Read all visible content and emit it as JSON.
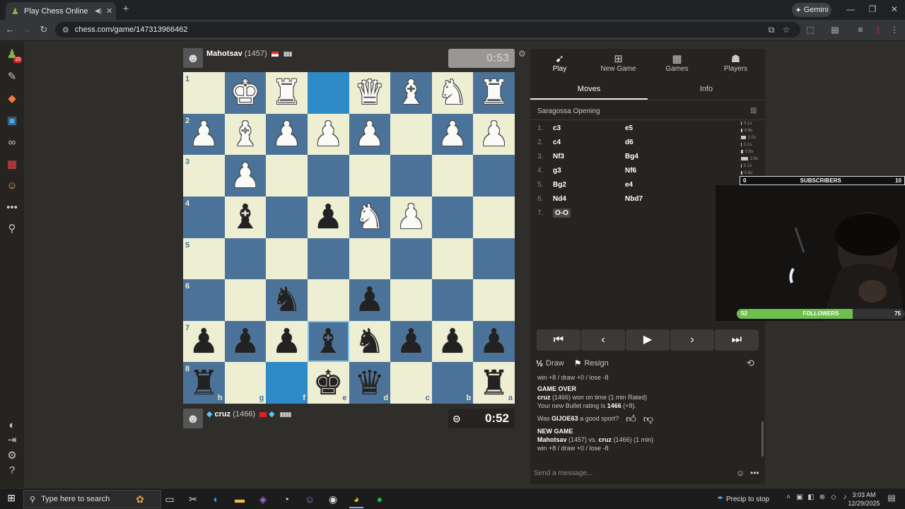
{
  "browser": {
    "tab_title": "Play Chess Online for FREE",
    "url": "chess.com/game/147313966462",
    "gemini_label": "Gemini"
  },
  "sidebar": {
    "badge": "15",
    "icons": [
      "pawn-logo-icon",
      "puzzle-icon",
      "learn-icon",
      "watch-icon",
      "binoculars-icon",
      "news-icon",
      "social-icon",
      "more-icon",
      "search-icon",
      "theme-icon",
      "logout-icon",
      "settings-icon",
      "help-icon"
    ]
  },
  "top_player": {
    "name": "Mahotsav",
    "rating": "(1457)",
    "clock": "0:53"
  },
  "bottom_player": {
    "name": "cruz",
    "rating": "(1466)",
    "clock": "0:52"
  },
  "board": {
    "ranks": [
      "1",
      "2",
      "3",
      "4",
      "5",
      "6",
      "7",
      "8"
    ],
    "files": [
      "h",
      "g",
      "f",
      "e",
      "d",
      "c",
      "b",
      "a"
    ],
    "squares": [
      [
        "",
        "wK",
        "wR",
        "",
        "wQ",
        "wB",
        "wN",
        "wR"
      ],
      [
        "wP",
        "wB",
        "wP",
        "wP",
        "wP",
        "",
        "wP",
        "wP"
      ],
      [
        "",
        "wP",
        "",
        "",
        "",
        "",
        "",
        ""
      ],
      [
        "",
        "bB",
        "",
        "bP",
        "wN",
        "wP",
        "",
        ""
      ],
      [
        "",
        "",
        "",
        "",
        "",
        "",
        "",
        ""
      ],
      [
        "",
        "",
        "bN",
        "",
        "bP",
        "",
        "",
        ""
      ],
      [
        "bP",
        "bP",
        "bP",
        "bB",
        "bN",
        "bP",
        "bP",
        "bP"
      ],
      [
        "bR",
        "",
        "",
        "bK",
        "bQ",
        "",
        "",
        "bR"
      ]
    ],
    "highlighted": [
      [
        0,
        3
      ],
      [
        7,
        2
      ]
    ],
    "selected": [
      6,
      3
    ]
  },
  "panel": {
    "tabs": [
      {
        "label": "Play",
        "icon": "play-icon"
      },
      {
        "label": "New Game",
        "icon": "plus-icon"
      },
      {
        "label": "Games",
        "icon": "games-icon"
      },
      {
        "label": "Players",
        "icon": "players-icon"
      }
    ],
    "subtabs": [
      "Moves",
      "Info"
    ],
    "opening": "Saragossa Opening",
    "moves": [
      {
        "n": "1.",
        "w": "c3",
        "b": "e5"
      },
      {
        "n": "2.",
        "w": "c4",
        "b": "d6"
      },
      {
        "n": "3.",
        "w": "Nf3",
        "b": "Bg4"
      },
      {
        "n": "4.",
        "w": "g3",
        "b": "Nf6"
      },
      {
        "n": "5.",
        "w": "Bg2",
        "b": "e4"
      },
      {
        "n": "6.",
        "w": "Nd4",
        "b": "Nbd7"
      },
      {
        "n": "7.",
        "w": "O-O",
        "b": ""
      }
    ],
    "move_times": [
      "0.1s",
      "0.6s",
      "2.0s",
      "0.1s",
      "0.9s",
      "2.9s",
      "0.1s",
      "0.6s",
      "0.1s"
    ],
    "draw_label": "Draw",
    "resign_label": "Resign",
    "half_label": "½"
  },
  "stream": {
    "subscribers_label": "SUBSCRIBERS",
    "subscribers_left": "0",
    "subscribers_right": "10",
    "followers_label": "FOLLOWERS",
    "followers_left": "52",
    "followers_right": "75",
    "followers_progress": 0.69
  },
  "chat": {
    "line_first": "win +8 / draw +0 / lose -8",
    "game_over": "GAME OVER",
    "won_name": "cruz",
    "won_text": " (1466) won on time (1 min Rated)",
    "rating_text": "Your new Bullet rating is ",
    "rating_value": "1466",
    "rating_delta": " (+8).",
    "sport_q1": "Was ",
    "sport_name": "GIJOE63",
    "sport_q2": " a good sport?",
    "new_game": "NEW GAME",
    "ng_p1": "Mahotsav",
    "ng_mid": " (1457) vs. ",
    "ng_p2": "cruz",
    "ng_tail": " (1466) (1 min)",
    "line_last": "win +8 / draw +0 / lose -8",
    "placeholder": "Send a message..."
  },
  "taskbar": {
    "search_placeholder": "Type here to search",
    "weather": "Precip to stop",
    "time": "3:03 AM",
    "date": "12/29/2025"
  }
}
